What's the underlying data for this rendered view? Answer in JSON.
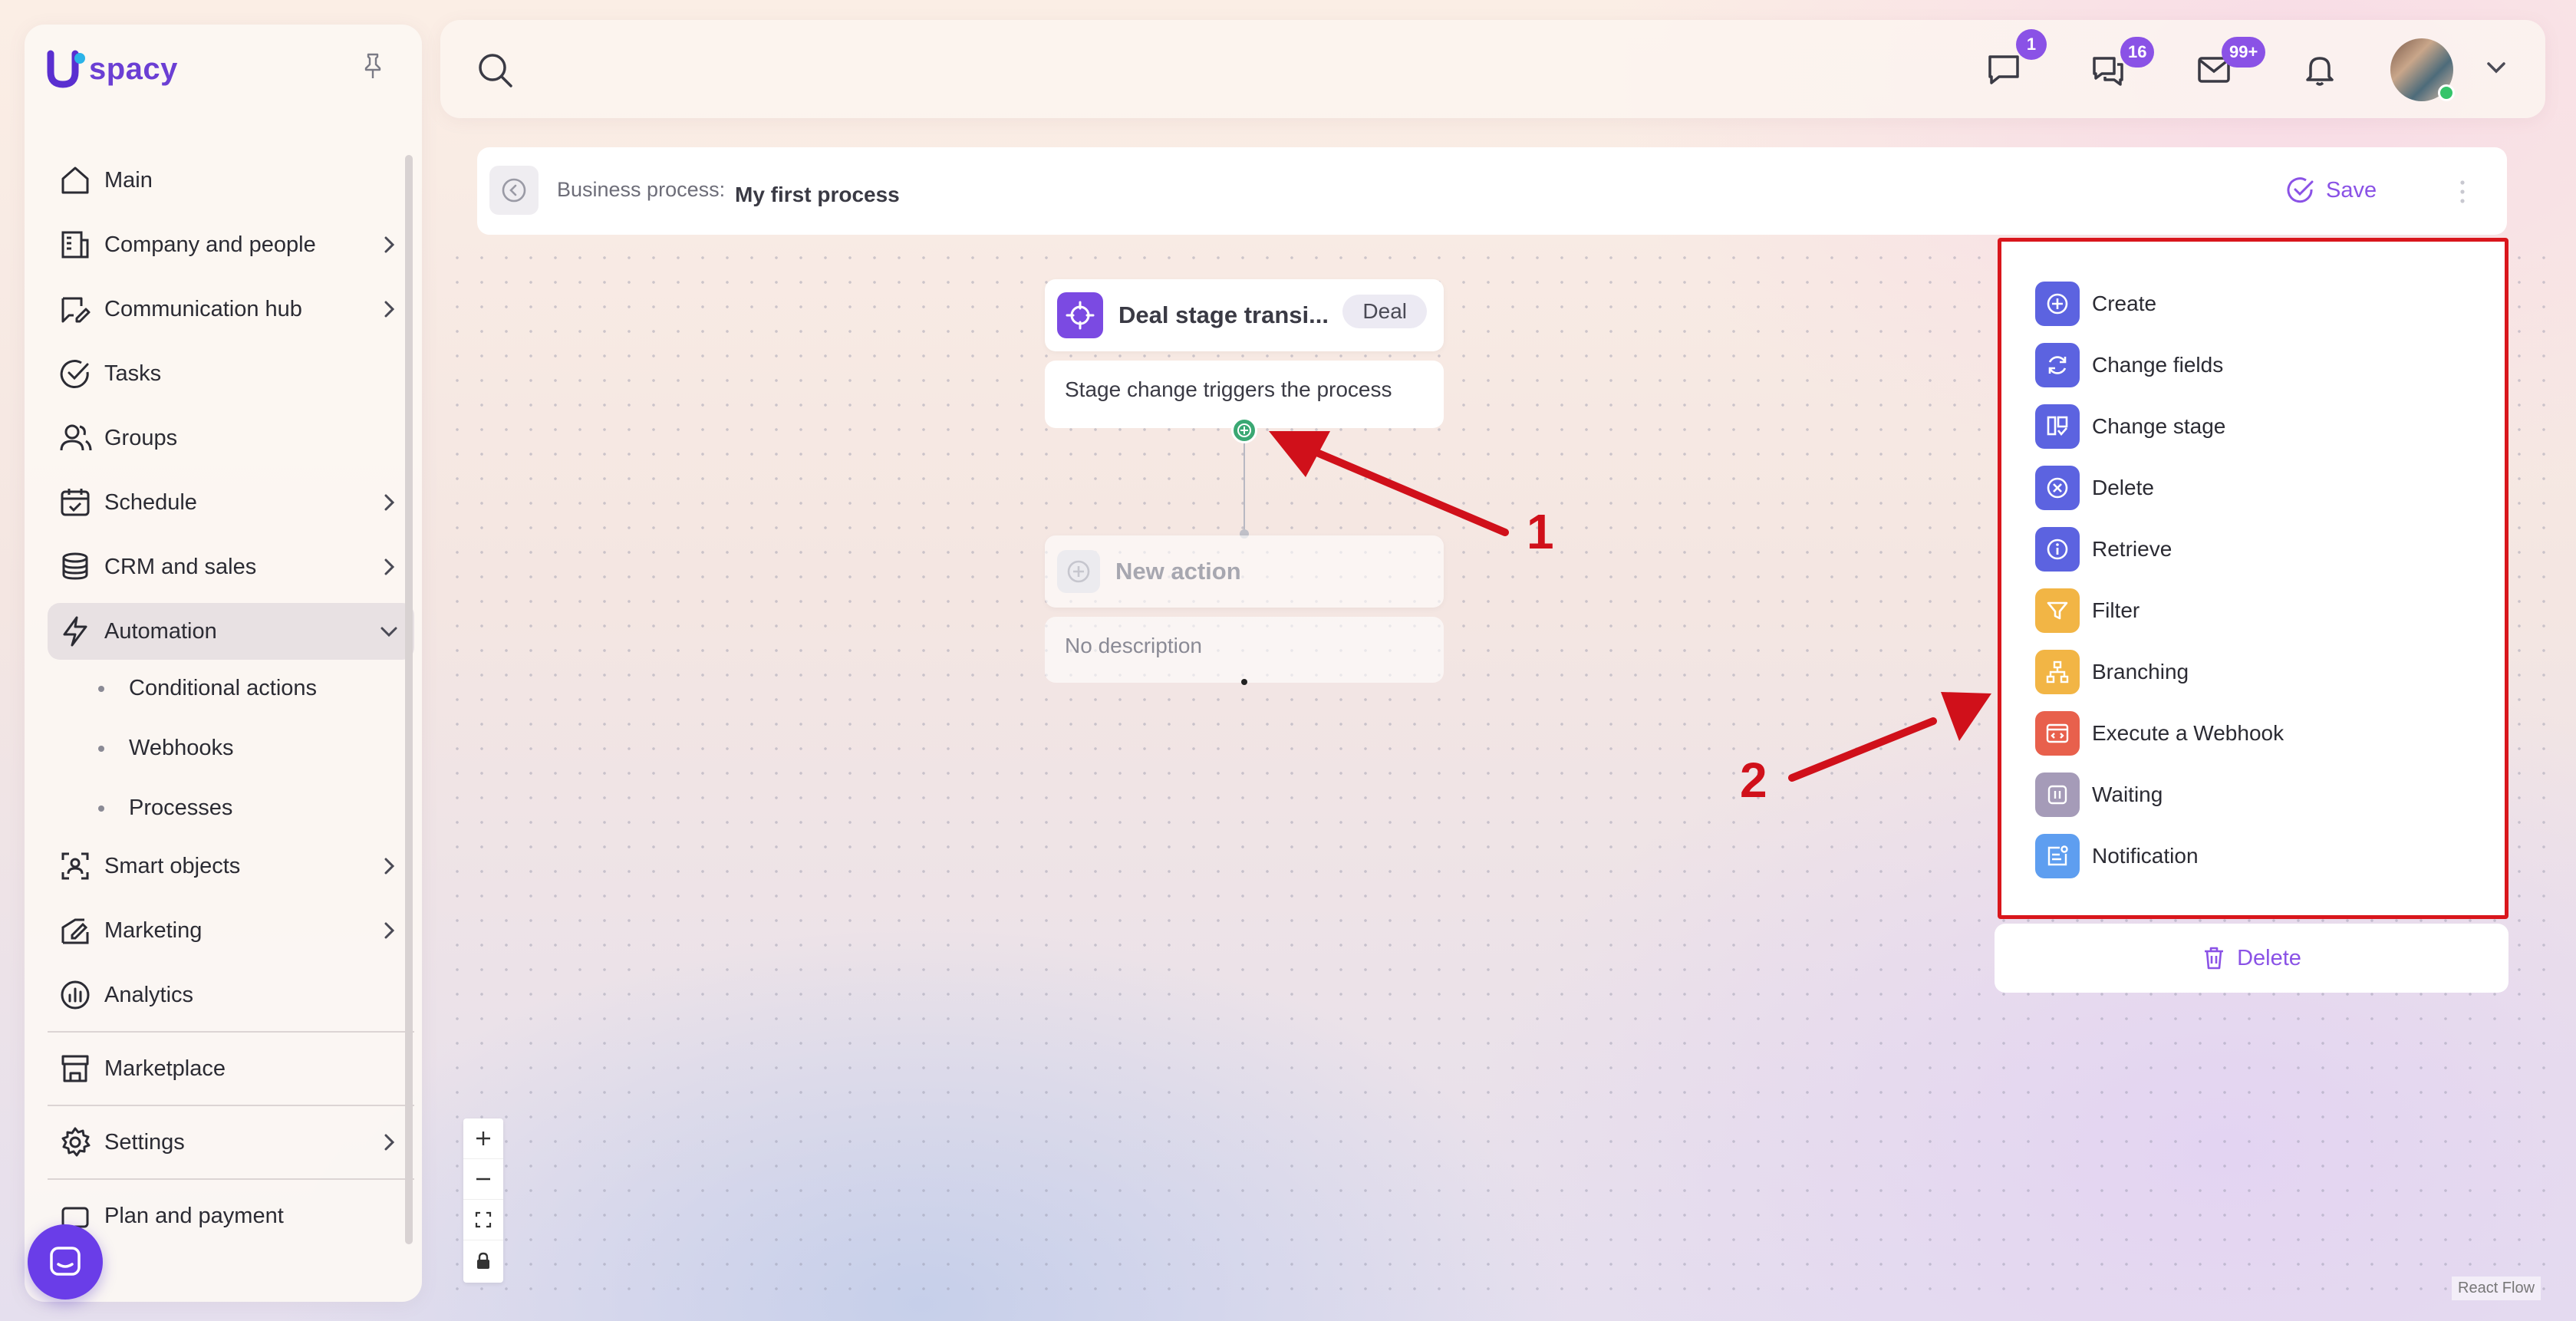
{
  "app": {
    "logo_text": "spacy",
    "accent_color": "#8a52e6"
  },
  "sidebar": {
    "items": [
      {
        "label": "Main",
        "icon": "home-icon",
        "has_chevron": false
      },
      {
        "label": "Company and people",
        "icon": "building-icon",
        "has_chevron": true
      },
      {
        "label": "Communication hub",
        "icon": "chat-edit-icon",
        "has_chevron": true
      },
      {
        "label": "Tasks",
        "icon": "check-circle-icon",
        "has_chevron": false
      },
      {
        "label": "Groups",
        "icon": "users-icon",
        "has_chevron": false
      },
      {
        "label": "Schedule",
        "icon": "calendar-icon",
        "has_chevron": true
      },
      {
        "label": "CRM and sales",
        "icon": "coins-icon",
        "has_chevron": true
      },
      {
        "label": "Automation",
        "icon": "lightning-icon",
        "has_chevron": true,
        "expanded": true
      }
    ],
    "automation_sub": [
      {
        "label": "Conditional actions"
      },
      {
        "label": "Webhooks"
      },
      {
        "label": "Processes"
      }
    ],
    "items_after": [
      {
        "label": "Smart objects",
        "icon": "smart-object-icon",
        "has_chevron": true
      },
      {
        "label": "Marketing",
        "icon": "marketing-icon",
        "has_chevron": true
      },
      {
        "label": "Analytics",
        "icon": "analytics-icon",
        "has_chevron": false
      }
    ],
    "marketplace": {
      "label": "Marketplace",
      "icon": "store-icon"
    },
    "settings": {
      "label": "Settings",
      "icon": "gear-icon"
    },
    "plan": {
      "label": "Plan and payment",
      "icon": "wallet-icon"
    }
  },
  "topbar": {
    "messages_badge": "1",
    "chats_badge": "16",
    "mail_badge": "99+"
  },
  "process": {
    "label": "Business process:",
    "name": "My first process",
    "save_label": "Save"
  },
  "nodes": {
    "trigger": {
      "title": "Deal stage transi...",
      "tag": "Deal",
      "description": "Stage change triggers the process"
    },
    "new_action": {
      "title": "New action",
      "description": "No description"
    }
  },
  "action_menu": {
    "items": [
      {
        "label": "Create",
        "icon": "plus-circle-icon",
        "color": "#5c63e0"
      },
      {
        "label": "Change fields",
        "icon": "refresh-icon",
        "color": "#5c63e0"
      },
      {
        "label": "Change stage",
        "icon": "kanban-icon",
        "color": "#5c63e0"
      },
      {
        "label": "Delete",
        "icon": "x-circle-icon",
        "color": "#5c63e0"
      },
      {
        "label": "Retrieve",
        "icon": "info-icon",
        "color": "#5c63e0"
      },
      {
        "label": "Filter",
        "icon": "filter-icon",
        "color": "#f2b545"
      },
      {
        "label": "Branching",
        "icon": "branch-icon",
        "color": "#f2b545"
      },
      {
        "label": "Execute a Webhook",
        "icon": "webhook-icon",
        "color": "#e8604c"
      },
      {
        "label": "Waiting",
        "icon": "pause-icon",
        "color": "#a59bb8"
      },
      {
        "label": "Notification",
        "icon": "notification-icon",
        "color": "#5e9ef0"
      }
    ],
    "delete_label": "Delete"
  },
  "annotations": {
    "one": "1",
    "two": "2"
  },
  "footer": {
    "react_flow": "React Flow"
  }
}
